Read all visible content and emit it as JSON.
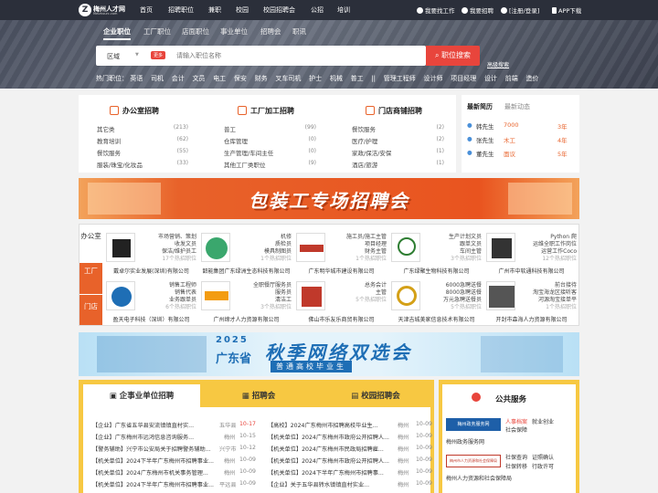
{
  "brand": {
    "name": "梅州人才网",
    "sub": "Meizhourc.com"
  },
  "nav": [
    "首页",
    "招聘职位",
    "兼职",
    "校园",
    "校园招聘会",
    "公招",
    "培训"
  ],
  "top_right": {
    "find_job": "我要找工作",
    "hire": "我要招聘",
    "login": "[注册/登录]",
    "app": "APP下载"
  },
  "search_tabs": [
    "企业职位",
    "工厂职位",
    "店面职位",
    "事业单位",
    "招聘会",
    "职讯"
  ],
  "search": {
    "region": "区域",
    "hot": "更多",
    "placeholder": "请输入职位名称",
    "button": "职位搜索",
    "advanced": "高级搜索"
  },
  "hot_keywords": {
    "label": "热门职位：",
    "items": [
      "英语",
      "司机",
      "会计",
      "文员",
      "电工",
      "保安",
      "财务",
      "叉车司机",
      "护士",
      "机械",
      "普工",
      "||",
      "管理工程师",
      "设计师",
      "项目经理",
      "设计",
      "前端",
      "造价"
    ]
  },
  "categories": [
    {
      "title": "办公室招聘",
      "rows": [
        [
          "其它类",
          "(213)"
        ],
        [
          "教育培训",
          "(62)"
        ],
        [
          "餐饮服务",
          "(55)"
        ],
        [
          "服装/珠宝/化妆品",
          "(33)"
        ]
      ]
    },
    {
      "title": "工厂加工招聘",
      "rows": [
        [
          "普工",
          "(99)"
        ],
        [
          "仓库管理",
          "(0)"
        ],
        [
          "生产管理/车间主任",
          "(0)"
        ],
        [
          "其他工厂类职位",
          "(9)"
        ]
      ]
    },
    {
      "title": "门店商铺招聘",
      "rows": [
        [
          "餐饮服务",
          "(2)"
        ],
        [
          "医疗/护理",
          "(2)"
        ],
        [
          "家政/保洁/安保",
          "(1)"
        ],
        [
          "酒店/旅游",
          "(1)"
        ]
      ]
    }
  ],
  "news": {
    "tabs": [
      "最新简历",
      "最新动态"
    ],
    "rows": [
      [
        "韩先生",
        "7000",
        "3年"
      ],
      [
        "张先生",
        "木工",
        "4年"
      ],
      [
        "董先生",
        "面议",
        "5年"
      ]
    ]
  },
  "banner_top": "包装工专场招聘会",
  "corp_side": [
    "办公室",
    "工厂",
    "门店"
  ],
  "companies": [
    {
      "jobs": [
        "市场营销、策划",
        "收发文员",
        "保洁/维护员工",
        "17个热招职位"
      ],
      "name": "戴卓尔实业发展(深圳)有限公司"
    },
    {
      "jobs": [
        "机修",
        "质检员",
        "模具制图员",
        "1个热招职位"
      ],
      "name": "韶能集团广东绿洲生态科技有限公司"
    },
    {
      "jobs": [
        "施工员/施工主管",
        "项目经理",
        "财务主管",
        "1个热招职位"
      ],
      "name": "广东明华城市建设有限公司"
    },
    {
      "jobs": [
        "生产计划文员",
        "跟单文员",
        "车间主管",
        "3个热招职位"
      ],
      "name": "广东绿聚生物科技有限公司"
    },
    {
      "jobs": [
        "Python 爬",
        "运维全职工作岗位",
        "运营工作Coco",
        "12个热招职位"
      ],
      "name": "广州市中软通科技有限公司"
    },
    {
      "jobs": [
        "销售工程师",
        "销售代表",
        "业务跟单员",
        "6个热招职位"
      ],
      "name": "盈天电子科技（深圳）有限公司"
    },
    {
      "jobs": [
        "全职餐厅服务员",
        "服务员",
        "清洁工",
        "3个热招职位"
      ],
      "name": "广州缔才人力资源有限公司"
    },
    {
      "jobs": [
        "总务会计",
        "主管",
        "5个热招职位"
      ],
      "name": "佛山市乐友乐商贸有限公司"
    },
    {
      "jobs": [
        "6000急聘送餐",
        "8000急聘送餐",
        "万元急聘送餐员",
        "5个热招职位"
      ],
      "name": "天津吉城美家信息技术有限公司"
    },
    {
      "jobs": [
        "前台接待",
        "淘宝海龙区接听客",
        "河源淘宝接单平",
        "1个热招职位"
      ],
      "name": "开封市森海人力资源有限公司"
    }
  ],
  "banner_bottom": {
    "year": "2025",
    "province": "广东省",
    "main": "秋季网络双选会",
    "sub": "普通高校毕业生"
  },
  "job_tabs": [
    "企事业单位招聘",
    "招聘会",
    "校园招聘会"
  ],
  "job_rows": {
    "left": [
      [
        "【企业】广东省五华县安流镇镇直村实...",
        "五华县",
        "10-17"
      ],
      [
        "【企业】广东梅州市远鸿信息咨询服务...",
        "梅州",
        "10-15"
      ],
      [
        "【警务辅助】兴宁市公安局关于招聘警务辅助...",
        "兴宁市",
        "10-12"
      ],
      [
        "【机关单位】2024下半年广东梅州市招聘事业...",
        "梅州",
        "10-09"
      ],
      [
        "【机关单位】2024广东梅州市机关事务管理...",
        "梅州",
        "10-09"
      ],
      [
        "【机关单位】2024下半年广东梅州市招聘事业...",
        "平远县",
        "10-09"
      ]
    ],
    "right": [
      [
        "【高校】2024广东梅州市招聘高校毕业生...",
        "梅州",
        "10-09"
      ],
      [
        "【机关单位】2024广东梅州市政府公开招聘人...",
        "梅州",
        "10-09"
      ],
      [
        "【机关单位】2024广东梅州市民政局招聘雇...",
        "梅州",
        "10-09"
      ],
      [
        "【机关单位】2024广东梅州市政府公开招聘人...",
        "梅州",
        "10-09"
      ],
      [
        "【机关单位】2024下半年广东梅州市招聘事...",
        "梅州",
        "10-09"
      ],
      [
        "【企业】关于五华县转水镇镇直村实业...",
        "梅州",
        "10-09"
      ]
    ]
  },
  "public_service": {
    "title": "公共服务",
    "items": [
      {
        "badge": "梅州政务服务网",
        "links": [
          "人事档案",
          "就业创业",
          "社会保障"
        ],
        "name": "梅州政务服务网"
      },
      {
        "badge": "梅州市人力资源和社会保障局",
        "links": [
          "社保查询",
          "证照确认",
          "社保转移",
          "行政许可"
        ],
        "name": "梅州人力资源和社会保障局"
      }
    ]
  },
  "colors": {
    "accent": "#e8453c",
    "orange": "#e8622a",
    "yellow": "#f7c842",
    "topbar": "#2b2f3a"
  }
}
